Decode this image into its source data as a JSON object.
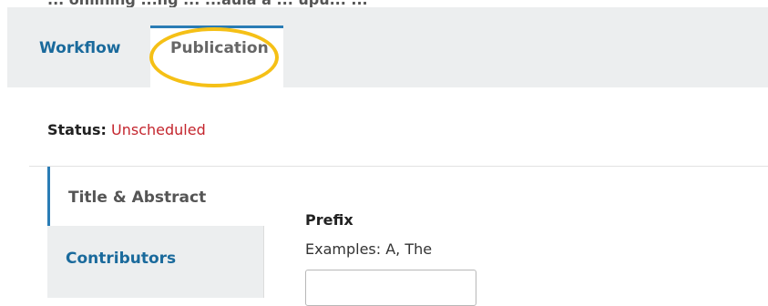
{
  "top_clipped_text": "... onlining ...ng ... ...aula a ... upu... ...",
  "tabs": [
    {
      "label": "Workflow"
    },
    {
      "label": "Publication"
    }
  ],
  "status": {
    "label": "Status:",
    "value": "Unscheduled"
  },
  "side_nav": {
    "items": [
      {
        "label": "Title & Abstract"
      },
      {
        "label": "Contributors"
      }
    ]
  },
  "form": {
    "prefix_label": "Prefix",
    "prefix_description": "Examples: A, The",
    "prefix_value": ""
  },
  "colors": {
    "accent": "#2a7cb5",
    "link": "#1a6a9c",
    "status_error": "#c4262e",
    "highlight": "#f5c016",
    "tab_bar_bg": "#eceeef"
  }
}
